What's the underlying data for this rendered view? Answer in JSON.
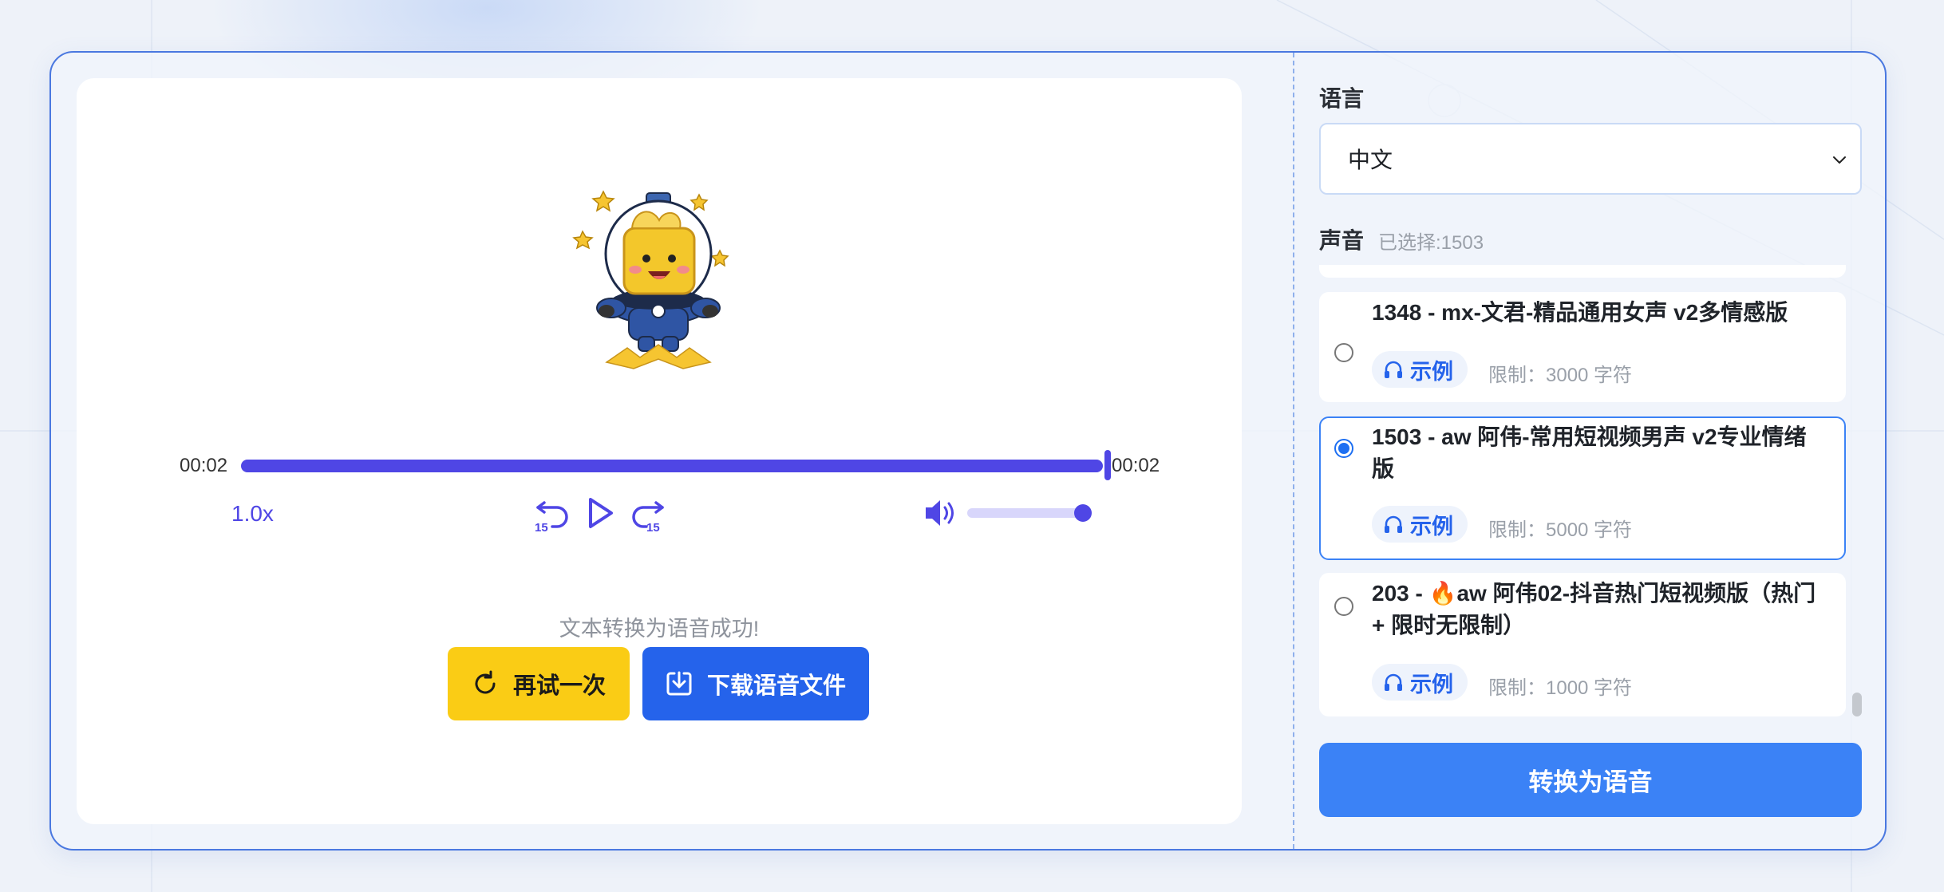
{
  "player": {
    "current_time": "00:02",
    "duration": "00:02",
    "progress": 1.0,
    "speed": "1.0x",
    "volume": 0.9,
    "accent_color": "#4f46e5"
  },
  "result": {
    "message": "文本转换为语音成功!",
    "retry_label": "再试一次",
    "download_label": "下载语音文件"
  },
  "language": {
    "label": "语言",
    "selected": "中文"
  },
  "voice": {
    "label": "声音",
    "selected_text": "已选择:1503",
    "items": [
      {
        "title": "1348 - mx-文君-精品通用女声 v2多情感版",
        "sample": "示例",
        "limit": "限制：3000 字符",
        "selected": false
      },
      {
        "title": "1503 - aw 阿伟-常用短视频男声 v2专业情绪版",
        "sample": "示例",
        "limit": "限制：5000 字符",
        "selected": true
      },
      {
        "title": "203 - 🔥aw 阿伟02-抖音热门短视频版（热门 + 限时无限制）",
        "sample": "示例",
        "limit": "限制：1000 字符",
        "selected": false
      }
    ]
  },
  "convert_label": "转换为语音",
  "colors": {
    "primary": "#2563eb",
    "retry": "#facc15",
    "convert": "#3b82f6",
    "border": "#4a78e0"
  }
}
